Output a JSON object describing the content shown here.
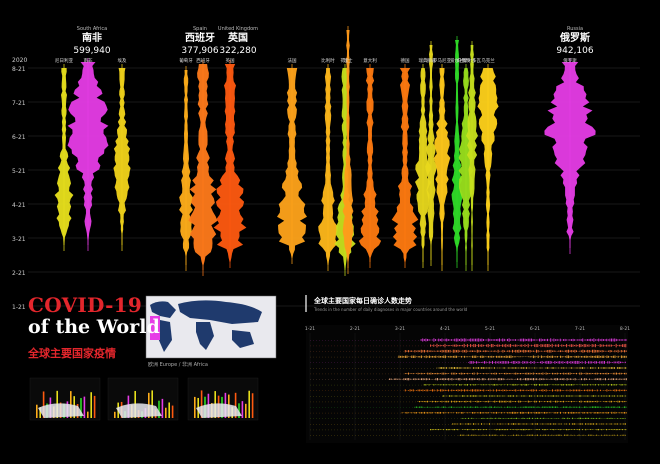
{
  "chart_data": {
    "type": "area",
    "year_label": "2020",
    "y_dates": [
      "8-21",
      "7-21",
      "6-21",
      "5-21",
      "4-21",
      "3-21",
      "2-21",
      "1-21"
    ],
    "highlighted": [
      {
        "en": "South Africa",
        "cn": "南非",
        "value": "599,940",
        "color": "#e63ce6"
      },
      {
        "en": "Spain",
        "cn": "西班牙",
        "value": "377,906",
        "color": "#ff7a1a"
      },
      {
        "en": "United Kingdom",
        "cn": "英国",
        "value": "322,280",
        "color": "#ff6a10"
      },
      {
        "en": "Russia",
        "cn": "俄罗斯",
        "value": "942,106",
        "color": "#e63ce6"
      }
    ],
    "series": [
      {
        "name": "尼日利亚",
        "x": 64,
        "top": 68,
        "bottom": 245,
        "max": 8,
        "peak": 0.75,
        "color": "#e8e01c"
      },
      {
        "name": "南非",
        "x": 88,
        "top": 62,
        "bottom": 245,
        "max": 20,
        "peak": 0.35,
        "color": "#e63ce6"
      },
      {
        "name": "埃及",
        "x": 122,
        "top": 68,
        "bottom": 245,
        "max": 8,
        "peak": 0.55,
        "color": "#f2d41a"
      },
      {
        "name": "葡萄牙",
        "x": 186,
        "top": 70,
        "bottom": 265,
        "max": 6,
        "peak": 0.7,
        "color": "#ffae1a"
      },
      {
        "name": "西班牙",
        "x": 203,
        "top": 64,
        "bottom": 270,
        "max": 14,
        "peak": 0.7,
        "color": "#ff7a1a"
      },
      {
        "name": "英国",
        "x": 230,
        "top": 64,
        "bottom": 262,
        "max": 15,
        "peak": 0.78,
        "color": "#ff5a10"
      },
      {
        "name": "法国",
        "x": 292,
        "top": 68,
        "bottom": 258,
        "max": 13,
        "peak": 0.8,
        "color": "#ffa31a"
      },
      {
        "name": "比利时",
        "x": 328,
        "top": 68,
        "bottom": 265,
        "max": 9,
        "peak": 0.85,
        "color": "#ffb81a"
      },
      {
        "name": "荷兰",
        "x": 345,
        "top": 68,
        "bottom": 270,
        "max": 9,
        "peak": 0.85,
        "color": "#c8e01c"
      },
      {
        "name": "瑞士",
        "x": 348,
        "top": 30,
        "bottom": 268,
        "max": 5,
        "peak": 0.78,
        "color": "#ff9a1a"
      },
      {
        "name": "意大利",
        "x": 370,
        "top": 68,
        "bottom": 262,
        "max": 10,
        "peak": 0.86,
        "color": "#ff7a10"
      },
      {
        "name": "德国",
        "x": 405,
        "top": 68,
        "bottom": 262,
        "max": 12,
        "peak": 0.84,
        "color": "#ff7a10"
      },
      {
        "name": "瑞典",
        "x": 423,
        "top": 68,
        "bottom": 262,
        "max": 7,
        "peak": 0.55,
        "color": "#e8d81c"
      },
      {
        "name": "挪威",
        "x": 431,
        "top": 45,
        "bottom": 260,
        "max": 5,
        "peak": 0.6,
        "color": "#e8d81c"
      },
      {
        "name": "罗马尼亚",
        "x": 442,
        "top": 68,
        "bottom": 265,
        "max": 7,
        "peak": 0.45,
        "color": "#ffc81a"
      },
      {
        "name": "爱尔兰",
        "x": 457,
        "top": 40,
        "bottom": 262,
        "max": 5,
        "peak": 0.7,
        "color": "#2fdc28"
      },
      {
        "name": "白俄罗斯",
        "x": 466,
        "top": 68,
        "bottom": 265,
        "max": 7,
        "peak": 0.5,
        "color": "#9ae01c"
      },
      {
        "name": "摩尔多瓦",
        "x": 472,
        "top": 45,
        "bottom": 265,
        "max": 5,
        "peak": 0.4,
        "color": "#c8e01c"
      },
      {
        "name": "乌克兰",
        "x": 488,
        "top": 68,
        "bottom": 265,
        "max": 9,
        "peak": 0.2,
        "color": "#ffd21a"
      },
      {
        "name": "俄罗斯",
        "x": 570,
        "top": 62,
        "bottom": 248,
        "max": 22,
        "peak": 0.35,
        "color": "#e63ce6"
      }
    ],
    "small_labels": [
      {
        "name": "瑞士",
        "x": 348,
        "top": 30
      },
      {
        "name": "挪威",
        "x": 431,
        "top": 40
      },
      {
        "name": "爱尔兰",
        "x": 457,
        "top": 35
      },
      {
        "name": "摩尔多瓦",
        "x": 472,
        "top": 40
      }
    ],
    "right_panel": {
      "title": "全球主要国家每日确诊人数走势",
      "subtitle": "Trends in the number of daily diagnoses in major countries around the world",
      "dates": [
        "1-21",
        "2-21",
        "3-21",
        "4-21",
        "5-21",
        "6-21",
        "7-21",
        "8-21"
      ],
      "rows": [
        {
          "color": "#e63ce6",
          "start": 0.35,
          "weight": 0.9
        },
        {
          "color": "#ff5a4a",
          "start": 0.38,
          "weight": 0.95
        },
        {
          "color": "#ff7a3a",
          "start": 0.3,
          "weight": 0.8
        },
        {
          "color": "#ffb23a",
          "start": 0.28,
          "weight": 0.7
        },
        {
          "color": "#e63ce6",
          "start": 0.5,
          "weight": 0.8
        },
        {
          "color": "#ffd23a",
          "start": 0.4,
          "weight": 0.5
        },
        {
          "color": "#ff9a3a",
          "start": 0.3,
          "weight": 0.55
        },
        {
          "color": "#ffb88a",
          "start": 0.25,
          "weight": 0.6
        },
        {
          "color": "#c8e01c",
          "start": 0.36,
          "weight": 0.45
        },
        {
          "color": "#ff7a10",
          "start": 0.3,
          "weight": 0.6
        },
        {
          "color": "#e8e01c",
          "start": 0.42,
          "weight": 0.4
        },
        {
          "color": "#ffb81a",
          "start": 0.34,
          "weight": 0.5
        },
        {
          "color": "#2fdc28",
          "start": 0.33,
          "weight": 0.45
        },
        {
          "color": "#ffa31a",
          "start": 0.29,
          "weight": 0.5
        },
        {
          "color": "#9ae01c",
          "start": 0.48,
          "weight": 0.35
        },
        {
          "color": "#ffc81a",
          "start": 0.45,
          "weight": 0.4
        },
        {
          "color": "#e8d81c",
          "start": 0.38,
          "weight": 0.35
        },
        {
          "color": "#ffd21a",
          "start": 0.47,
          "weight": 0.3
        }
      ]
    }
  },
  "titles": {
    "covid": "COVID-19",
    "world": "of the World",
    "cn": "全球主要国家疫情"
  },
  "map_caption": "欧洲 Europe / 非洲 Africa"
}
